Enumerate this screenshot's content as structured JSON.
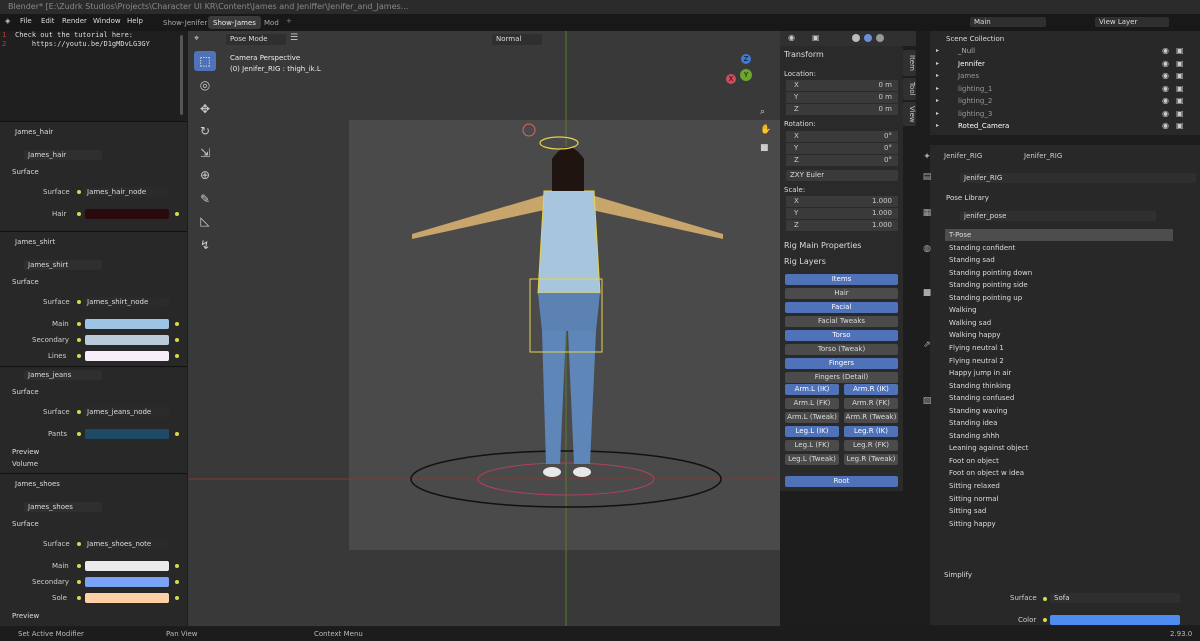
{
  "window_title": "Blender* [E:\\Zudrk Studios\\Projects\\Character UI KR\\Content\\James and Jeniffer\\Jenifer_and_James...",
  "menu": [
    "File",
    "Edit",
    "Render",
    "Window",
    "Help"
  ],
  "workspaces": [
    "Show-Jenifer",
    "Show-James",
    "Mod"
  ],
  "text_editor": {
    "lines": [
      "Check out the tutorial here:",
      "    https://youtu.be/D1gMDvLG3GY"
    ]
  },
  "material_panels": [
    {
      "title": "James_hair",
      "material": "James_hair",
      "section": "Surface",
      "surface_label": "Surface",
      "surface_value": "James_hair_node",
      "params": [
        {
          "label": "Hair",
          "color": "#2a0a0c"
        }
      ]
    },
    {
      "title": "James_shirt",
      "material": "James_shirt",
      "section": "Surface",
      "surface_label": "Surface",
      "surface_value": "James_shirt_node",
      "params": [
        {
          "label": "Main",
          "color": "#9ec4e4"
        },
        {
          "label": "Secondary",
          "color": "#b9cad8"
        },
        {
          "label": "Lines",
          "color": "#f8eefa"
        }
      ]
    },
    {
      "title": "",
      "material": "James_jeans",
      "section": "Surface",
      "surface_label": "Surface",
      "surface_value": "James_jeans_node",
      "params": [
        {
          "label": "Pants",
          "color": "#1f4a66"
        }
      ],
      "extra": [
        "Preview",
        "Volume"
      ]
    },
    {
      "title": "James_shoes",
      "material": "James_shoes",
      "section": "Surface",
      "surface_label": "Surface",
      "surface_value": "James_shoes_note",
      "params": [
        {
          "label": "Main",
          "color": "#ebebeb"
        },
        {
          "label": "Secondary",
          "color": "#7aa3f6"
        },
        {
          "label": "Sole",
          "color": "#ffd0a6"
        }
      ],
      "extra": [
        "Preview"
      ]
    }
  ],
  "viewport": {
    "mode": "Pose Mode",
    "orientation": "Normal",
    "camera": "Camera Perspective",
    "object": "(0) Jenifer_RIG : thigh_ik.L",
    "gizmo": {
      "x": "X",
      "y": "Y",
      "z": "Z"
    }
  },
  "npanel": {
    "transform": "Transform",
    "location_label": "Location:",
    "location": [
      {
        "k": "X",
        "v": "0 m"
      },
      {
        "k": "Y",
        "v": "0 m"
      },
      {
        "k": "Z",
        "v": "0 m"
      }
    ],
    "rotation_label": "Rotation:",
    "rotation": [
      {
        "k": "X",
        "v": "0°"
      },
      {
        "k": "Y",
        "v": "0°"
      },
      {
        "k": "Z",
        "v": "0°"
      }
    ],
    "rot_mode": "ZXY Euler",
    "scale_label": "Scale:",
    "scale": [
      {
        "k": "X",
        "v": "1.000"
      },
      {
        "k": "Y",
        "v": "1.000"
      },
      {
        "k": "Z",
        "v": "1.000"
      }
    ],
    "rig_main": "Rig Main Properties",
    "rig_layers": "Rig Layers",
    "tabs": [
      "Item",
      "Tool",
      "View"
    ],
    "layers_full": [
      {
        "l": "Items",
        "on": true
      },
      {
        "l": "Hair",
        "on": false
      },
      {
        "l": "Facial",
        "on": true
      },
      {
        "l": "Facial Tweaks",
        "on": false
      },
      {
        "l": "Torso",
        "on": true
      },
      {
        "l": "Torso (Tweak)",
        "on": false
      },
      {
        "l": "Fingers",
        "on": true
      },
      {
        "l": "Fingers (Detail)",
        "on": false
      }
    ],
    "layers_pairs": [
      [
        {
          "l": "Arm.L (IK)",
          "on": true
        },
        {
          "l": "Arm.R (IK)",
          "on": true
        }
      ],
      [
        {
          "l": "Arm.L (FK)",
          "on": false
        },
        {
          "l": "Arm.R (FK)",
          "on": false
        }
      ],
      [
        {
          "l": "Arm.L (Tweak)",
          "on": false
        },
        {
          "l": "Arm.R (Tweak)",
          "on": false
        }
      ],
      [
        {
          "l": "Leg.L (IK)",
          "on": true
        },
        {
          "l": "Leg.R (IK)",
          "on": true
        }
      ],
      [
        {
          "l": "Leg.L (FK)",
          "on": false
        },
        {
          "l": "Leg.R (FK)",
          "on": false
        }
      ],
      [
        {
          "l": "Leg.L (Tweak)",
          "on": false
        },
        {
          "l": "Leg.R (Tweak)",
          "on": false
        }
      ]
    ],
    "root": "Root"
  },
  "outliner": {
    "scene": "Main",
    "view_layer": "View Layer",
    "collection": "Scene Collection",
    "items": [
      "_Null",
      "Jennifer",
      "James",
      "lighting_1",
      "lighting_2",
      "lighting_3",
      "Roted_Camera"
    ]
  },
  "properties": {
    "breadcrumb_a": "Jenifer_RIG",
    "breadcrumb_b": "Jenifer_RIG",
    "object": "Jenifer_RIG",
    "pose_library": "Pose Library",
    "library": "jenifer_pose",
    "poses": [
      "T-Pose",
      "Standing confident",
      "Standing sad",
      "Standing pointing down",
      "Standing pointing side",
      "Standing pointing up",
      "Walking",
      "Walking sad",
      "Walking happy",
      "Flying neutral 1",
      "Flying neutral 2",
      "Happy jump in air",
      "Standing thinking",
      "Standing confused",
      "Standing waving",
      "Standing idea",
      "Standing shhh",
      "Leaning against object",
      "Foot on object",
      "Foot on object w idea",
      "Sitting relaxed",
      "Sitting normal",
      "Sitting sad",
      "Sitting happy"
    ],
    "simplify": "Simplify",
    "surface_label": "Surface",
    "surface_value": "Sofa",
    "color_label": "Color",
    "color": "#4e8cf2"
  },
  "status": {
    "left": "Set Active Modifier",
    "mid": "Pan View",
    "right": "Context Menu",
    "version": "2.93.0"
  }
}
